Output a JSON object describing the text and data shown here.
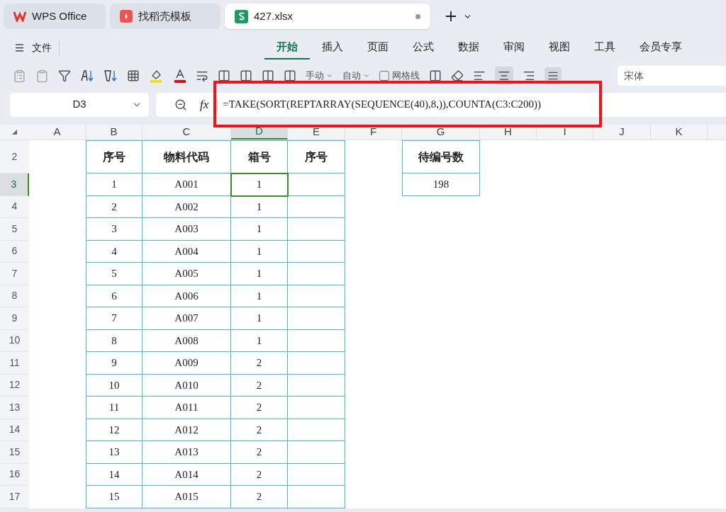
{
  "tabs": [
    {
      "label": "WPS Office",
      "kind": "wps",
      "selected": false
    },
    {
      "label": "找稻壳模板",
      "kind": "docer",
      "selected": false
    },
    {
      "label": "427.xlsx",
      "kind": "sheet",
      "selected": true
    }
  ],
  "menu": {
    "file": "文件",
    "ribbon": [
      {
        "label": "开始",
        "selected": true
      },
      {
        "label": "插入",
        "selected": false
      },
      {
        "label": "页面",
        "selected": false
      },
      {
        "label": "公式",
        "selected": false
      },
      {
        "label": "数据",
        "selected": false
      },
      {
        "label": "审阅",
        "selected": false
      },
      {
        "label": "视图",
        "selected": false
      },
      {
        "label": "工具",
        "selected": false
      },
      {
        "label": "会员专享",
        "selected": false
      }
    ]
  },
  "toolbar": {
    "manual": "手动",
    "auto": "自动",
    "gridlines": "网格线",
    "gridlines_checked": false,
    "font": "宋体"
  },
  "formula_bar": {
    "cell": "D3",
    "fx": "fx",
    "formula": "=TAKE(SORT(REPTARRAY(SEQUENCE(40),8,)),COUNTA(C3:C200))"
  },
  "columns": [
    {
      "label": "A",
      "selected": false
    },
    {
      "label": "B",
      "selected": false
    },
    {
      "label": "C",
      "selected": false
    },
    {
      "label": "D",
      "selected": true
    },
    {
      "label": "E",
      "selected": false
    },
    {
      "label": "F",
      "selected": false
    },
    {
      "label": "G",
      "selected": false
    },
    {
      "label": "H",
      "selected": false
    },
    {
      "label": "I",
      "selected": false
    },
    {
      "label": "J",
      "selected": false
    },
    {
      "label": "K",
      "selected": false
    }
  ],
  "rows": [
    {
      "label": "2",
      "selected": false,
      "B": "序号",
      "C": "物料代码",
      "D": "箱号",
      "E": "序号",
      "G": "待编号数"
    },
    {
      "label": "3",
      "selected": true,
      "B": "1",
      "C": "A001",
      "D": "1",
      "G": "198"
    },
    {
      "label": "4",
      "selected": false,
      "B": "2",
      "C": "A002",
      "D": "1"
    },
    {
      "label": "5",
      "selected": false,
      "B": "3",
      "C": "A003",
      "D": "1"
    },
    {
      "label": "6",
      "selected": false,
      "B": "4",
      "C": "A004",
      "D": "1"
    },
    {
      "label": "7",
      "selected": false,
      "B": "5",
      "C": "A005",
      "D": "1"
    },
    {
      "label": "8",
      "selected": false,
      "B": "6",
      "C": "A006",
      "D": "1"
    },
    {
      "label": "9",
      "selected": false,
      "B": "7",
      "C": "A007",
      "D": "1"
    },
    {
      "label": "10",
      "selected": false,
      "B": "8",
      "C": "A008",
      "D": "1"
    },
    {
      "label": "11",
      "selected": false,
      "B": "9",
      "C": "A009",
      "D": "2"
    },
    {
      "label": "12",
      "selected": false,
      "B": "10",
      "C": "A010",
      "D": "2"
    },
    {
      "label": "13",
      "selected": false,
      "B": "11",
      "C": "A011",
      "D": "2"
    },
    {
      "label": "14",
      "selected": false,
      "B": "12",
      "C": "A012",
      "D": "2"
    },
    {
      "label": "15",
      "selected": false,
      "B": "13",
      "C": "A013",
      "D": "2"
    },
    {
      "label": "16",
      "selected": false,
      "B": "14",
      "C": "A014",
      "D": "2"
    },
    {
      "label": "17",
      "selected": false,
      "B": "15",
      "C": "A015",
      "D": "2"
    }
  ]
}
